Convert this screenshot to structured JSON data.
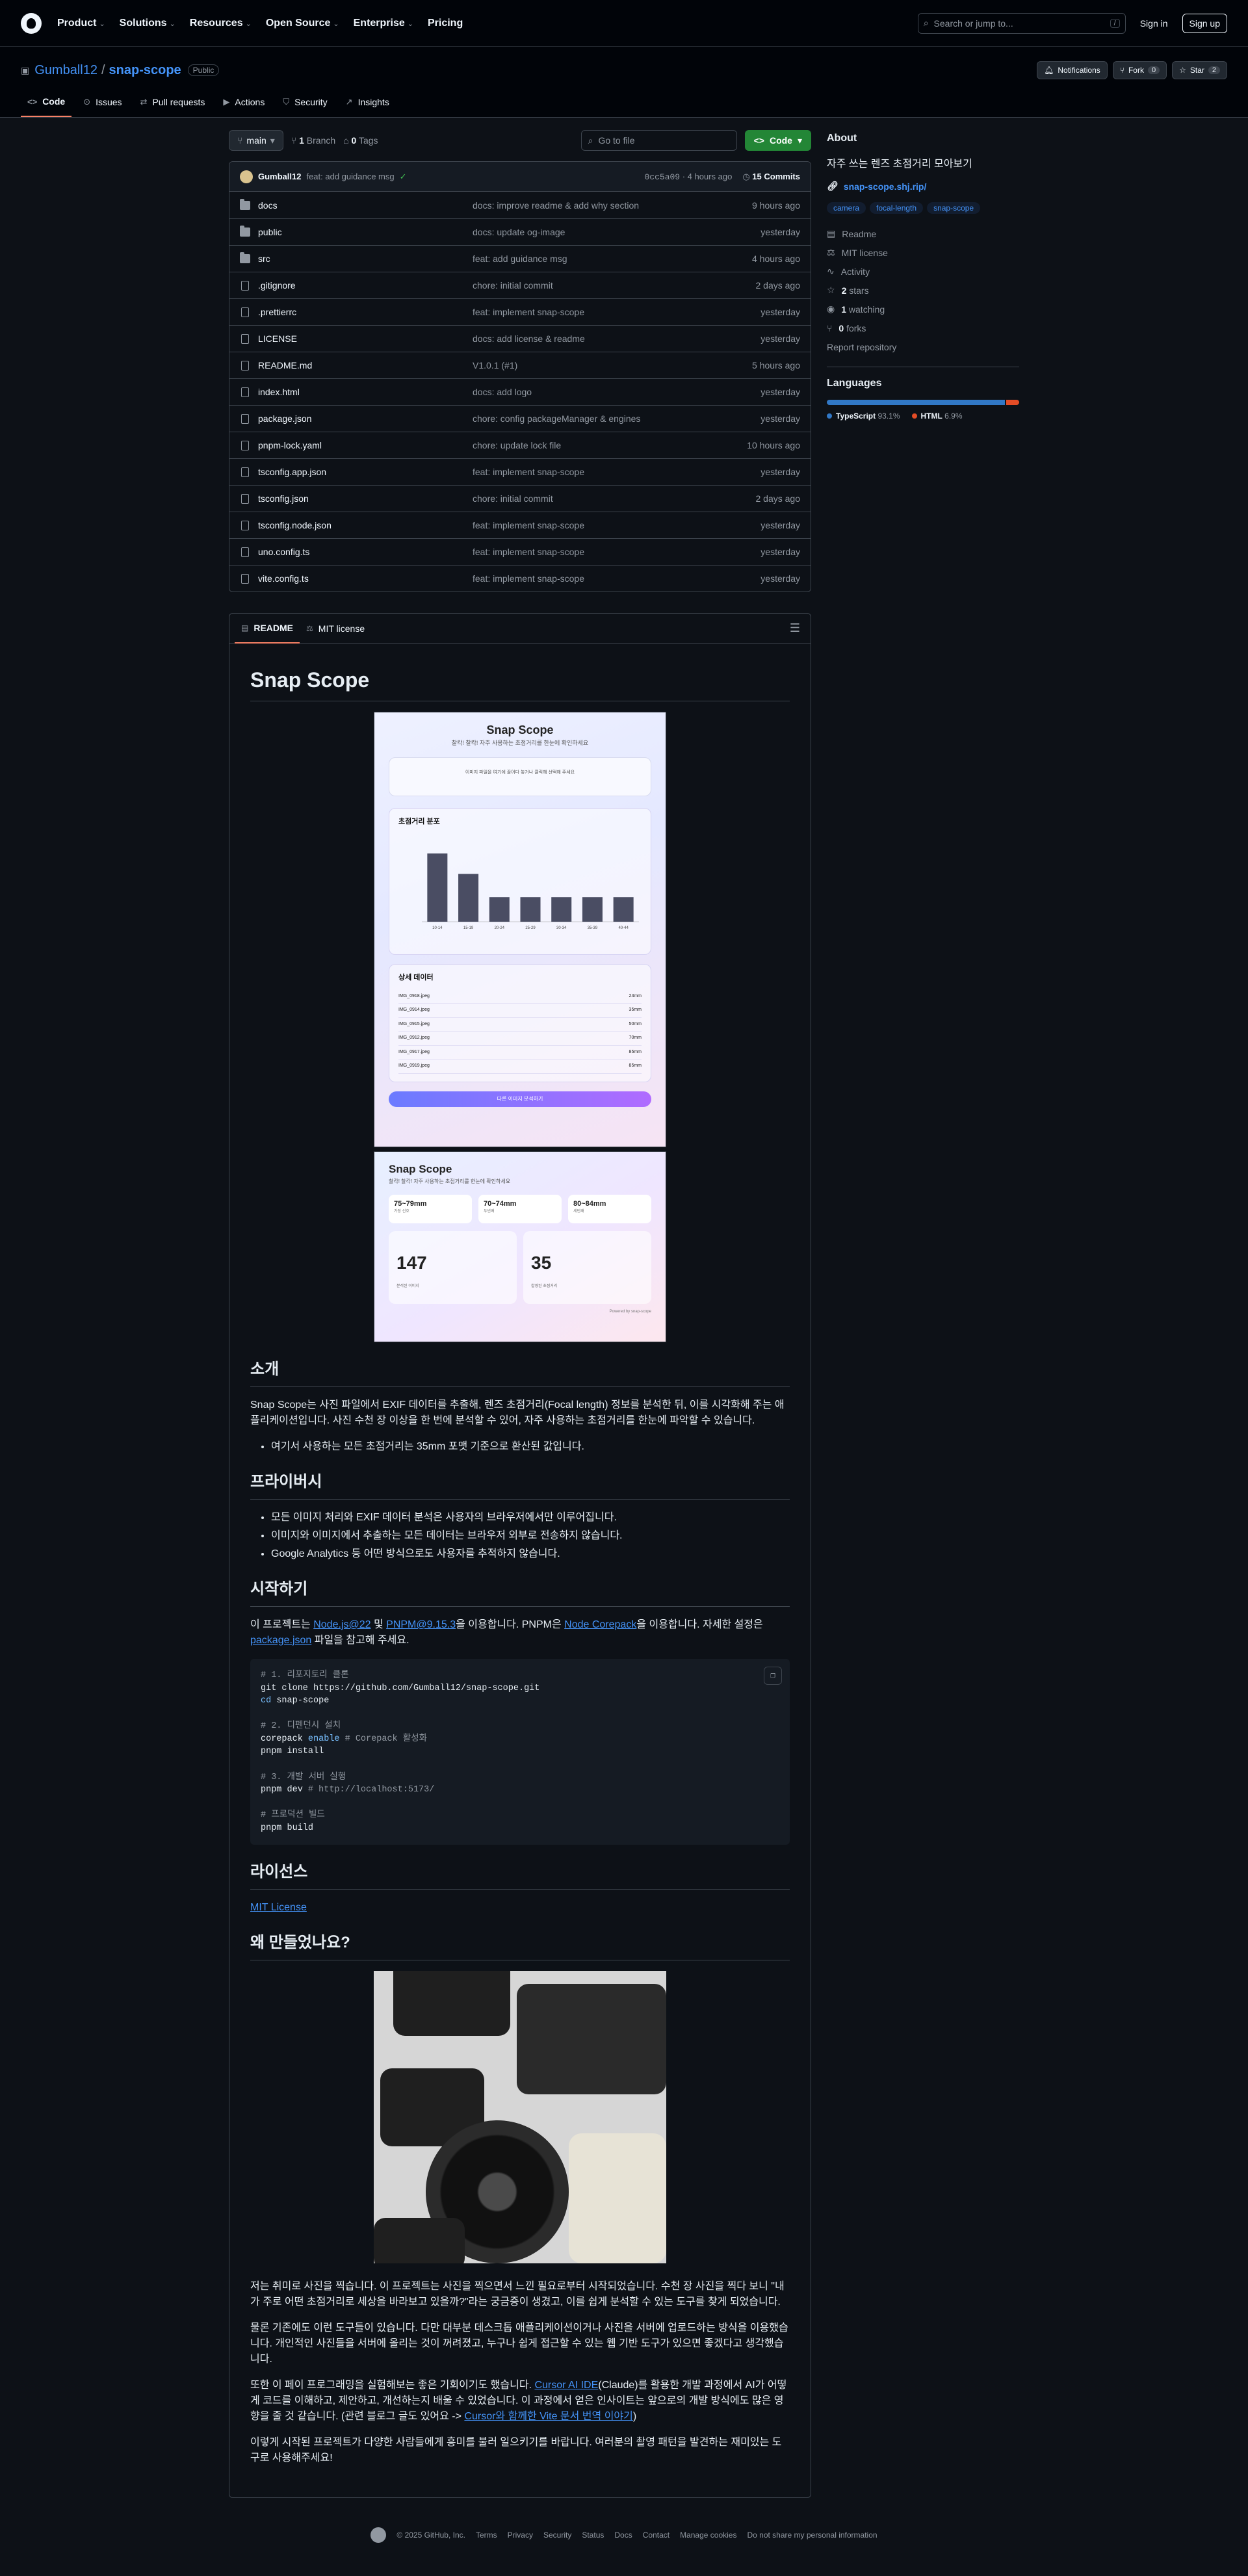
{
  "header": {
    "nav": [
      "Product",
      "Solutions",
      "Resources",
      "Open Source",
      "Enterprise",
      "Pricing"
    ],
    "search_placeholder": "Search or jump to...",
    "search_kbd": "/",
    "signin": "Sign in",
    "signup": "Sign up"
  },
  "repo": {
    "owner": "Gumball12",
    "name": "snap-scope",
    "visibility": "Public",
    "notifications": "Notifications",
    "fork_label": "Fork",
    "fork_count": "0",
    "star_label": "Star",
    "star_count": "2",
    "tabs": [
      "Code",
      "Issues",
      "Pull requests",
      "Actions",
      "Security",
      "Insights"
    ]
  },
  "filebar": {
    "branch": "main",
    "branches_count": "1",
    "branches_label": "Branch",
    "tags_count": "0",
    "tags_label": "Tags",
    "goto_placeholder": "Go to file",
    "code_button": "Code"
  },
  "commit": {
    "author": "Gumball12",
    "message": "feat: add guidance msg",
    "hash": "0cc5a09",
    "time": "4 hours ago",
    "count_label": "15 Commits"
  },
  "files": [
    {
      "name": "docs",
      "type": "dir",
      "msg": "docs: improve readme & add why section",
      "date": "9 hours ago"
    },
    {
      "name": "public",
      "type": "dir",
      "msg": "docs: update og-image",
      "date": "yesterday"
    },
    {
      "name": "src",
      "type": "dir",
      "msg": "feat: add guidance msg",
      "date": "4 hours ago"
    },
    {
      "name": ".gitignore",
      "type": "file",
      "msg": "chore: initial commit",
      "date": "2 days ago"
    },
    {
      "name": ".prettierrc",
      "type": "file",
      "msg": "feat: implement snap-scope",
      "date": "yesterday"
    },
    {
      "name": "LICENSE",
      "type": "file",
      "msg": "docs: add license & readme",
      "date": "yesterday"
    },
    {
      "name": "README.md",
      "type": "file",
      "msg": "V1.0.1 (#1)",
      "date": "5 hours ago"
    },
    {
      "name": "index.html",
      "type": "file",
      "msg": "docs: add logo",
      "date": "yesterday"
    },
    {
      "name": "package.json",
      "type": "file",
      "msg": "chore: config packageManager & engines",
      "date": "yesterday"
    },
    {
      "name": "pnpm-lock.yaml",
      "type": "file",
      "msg": "chore: update lock file",
      "date": "10 hours ago"
    },
    {
      "name": "tsconfig.app.json",
      "type": "file",
      "msg": "feat: implement snap-scope",
      "date": "yesterday"
    },
    {
      "name": "tsconfig.json",
      "type": "file",
      "msg": "chore: initial commit",
      "date": "2 days ago"
    },
    {
      "name": "tsconfig.node.json",
      "type": "file",
      "msg": "feat: implement snap-scope",
      "date": "yesterday"
    },
    {
      "name": "uno.config.ts",
      "type": "file",
      "msg": "feat: implement snap-scope",
      "date": "yesterday"
    },
    {
      "name": "vite.config.ts",
      "type": "file",
      "msg": "feat: implement snap-scope",
      "date": "yesterday"
    }
  ],
  "readme_tabs": [
    "README",
    "MIT license"
  ],
  "readme": {
    "title": "Snap Scope",
    "shot1": {
      "title": "Snap Scope",
      "subtitle": "찰칵! 찰칵! 자주 사용하는 초점거리를 한눈에 확인하세요",
      "drop_text": "이미지 파일을 여기에 끌어다 놓거나 클릭해 선택해 주세요",
      "chart_title": "초점거리 분포",
      "table_title": "상세 데이터",
      "table_rows": [
        {
          "file": "IMG_0918.jpeg",
          "value": "24mm"
        },
        {
          "file": "IMG_0914.jpeg",
          "value": "35mm"
        },
        {
          "file": "IMG_0915.jpeg",
          "value": "50mm"
        },
        {
          "file": "IMG_0912.jpeg",
          "value": "70mm"
        },
        {
          "file": "IMG_0917.jpeg",
          "value": "85mm"
        },
        {
          "file": "IMG_0919.jpeg",
          "value": "85mm"
        }
      ],
      "cta": "다른 이미지 분석하기"
    },
    "shot2": {
      "title": "Snap Scope",
      "subtitle": "찰칵! 찰칵! 자주 사용하는 초점거리를 한눈에 확인하세요",
      "pills": [
        {
          "value": "75~79mm",
          "sub": "가장 선호"
        },
        {
          "value": "70~74mm",
          "sub": "두번째"
        },
        {
          "value": "80~84mm",
          "sub": "세번째"
        }
      ],
      "stats": [
        {
          "value": "147",
          "sub": "분석된 이미지"
        },
        {
          "value": "35",
          "sub": "촬영된 초점거리"
        }
      ],
      "footer": "Powered by snap-scope"
    },
    "intro_h": "소개",
    "intro_p": "Snap Scope는 사진 파일에서 EXIF 데이터를 추출해, 렌즈 초점거리(Focal length) 정보를 분석한 뒤, 이를 시각화해 주는 애플리케이션입니다. 사진 수천 장 이상을 한 번에 분석할 수 있어, 자주 사용하는 초점거리를 한눈에 파악할 수 있습니다.",
    "intro_li": "여기서 사용하는 모든 초점거리는 35mm 포맷 기준으로 환산된 값입니다.",
    "privacy_h": "프라이버시",
    "privacy_li": [
      "모든 이미지 처리와 EXIF 데이터 분석은 사용자의 브라우저에서만 이루어집니다.",
      "이미지와 이미지에서 추출하는 모든 데이터는 브라우저 외부로 전송하지 않습니다.",
      "Google Analytics 등 어떤 방식으로도 사용자를 추적하지 않습니다."
    ],
    "start_h": "시작하기",
    "start_p1": "이 프로젝트는 ",
    "start_link1": "Node.js@22",
    "start_p2": " 및 ",
    "start_link2": "PNPM@9.15.3",
    "start_p3": "을 이용합니다. PNPM은 ",
    "start_link3": "Node Corepack",
    "start_p4": "을 이용합니다. 자세한 설정은 ",
    "start_link4": "package.json",
    "start_p5": " 파일을 참고해 주세요.",
    "code": {
      "c1": "# 1. 리포지토리 클론",
      "l1": "git clone https://github.com/Gumball12/snap-scope.git",
      "l2": "cd snap-scope",
      "c2": "# 2. 디펜던시 설치",
      "l3a": "corepack ",
      "l3b": "enable",
      "l3c": " # Corepack 활성화",
      "l4": "pnpm install",
      "c3": "# 3. 개발 서버 실행",
      "l5a": "pnpm dev",
      "l5b": " # http://localhost:5173/",
      "c4": "# 프로덕션 빌드",
      "l6": "pnpm build"
    },
    "license_h": "라이선스",
    "license_link": "MIT License",
    "why_h": "왜 만들었나요?",
    "why_p1": "저는 취미로 사진을 찍습니다. 이 프로젝트는 사진을 찍으면서 느낀 필요로부터 시작되었습니다. 수천 장 사진을 찍다 보니 \"내가 주로 어떤 초점거리로 세상을 바라보고 있을까?\"라는 궁금증이 생겼고, 이를 쉽게 분석할 수 있는 도구를 찾게 되었습니다.",
    "why_p2": "물론 기존에도 이런 도구들이 있습니다. 다만 대부분 데스크톱 애플리케이션이거나 사진을 서버에 업로드하는 방식을 이용했습니다. 개인적인 사진들을 서버에 올리는 것이 꺼려졌고, 누구나 쉽게 접근할 수 있는 웹 기반 도구가 있으면 좋겠다고 생각했습니다.",
    "why_p3a": "또한 이 페이 프로그래밍을 실험해보는 좋은 기회이기도 했습니다. ",
    "why_link1": "Cursor AI IDE",
    "why_p3b": "(Claude)를 활용한 개발 과정에서 AI가 어떻게 코드를 이해하고, 제안하고, 개선하는지 배울 수 있었습니다. 이 과정에서 얻은 인사이트는 앞으로의 개발 방식에도 많은 영향을 줄 것 같습니다. (관련 블로그 글도 있어요 -> ",
    "why_link2": "Cursor와 함께한 Vite 문서 번역 이야기",
    "why_p3c": ")",
    "why_p4": "이렇게 시작된 프로젝트가 다양한 사람들에게 흥미를 불러 일으키기를 바랍니다. 여러분의 촬영 패턴을 발견하는 재미있는 도구로 사용해주세요!"
  },
  "chart_data": {
    "type": "bar",
    "categories": [
      "10-14",
      "15-19",
      "20-24",
      "25-29",
      "30-34",
      "35-39",
      "40-44"
    ],
    "values": [
      5,
      3.5,
      1.8,
      1.8,
      1.8,
      1.8,
      1.8
    ],
    "ylim": [
      0,
      6
    ]
  },
  "about": {
    "heading": "About",
    "description": "자주 쓰는 렌즈 초점거리 모아보기",
    "website": "snap-scope.shj.rip/",
    "topics": [
      "camera",
      "focal-length",
      "snap-scope"
    ],
    "readme": "Readme",
    "license": "MIT license",
    "activity": "Activity",
    "stars_count": "2",
    "stars_label": "stars",
    "watching_count": "1",
    "watching_label": "watching",
    "forks_count": "0",
    "forks_label": "forks",
    "report": "Report repository"
  },
  "languages": {
    "heading": "Languages",
    "items": [
      {
        "name": "TypeScript",
        "percent": "93.1%",
        "value": 93.1,
        "color": "#3178c6"
      },
      {
        "name": "HTML",
        "percent": "6.9%",
        "value": 6.9,
        "color": "#e34c26"
      }
    ]
  },
  "footer": {
    "copyright": "© 2025 GitHub, Inc.",
    "links": [
      "Terms",
      "Privacy",
      "Security",
      "Status",
      "Docs",
      "Contact",
      "Manage cookies",
      "Do not share my personal information"
    ]
  }
}
